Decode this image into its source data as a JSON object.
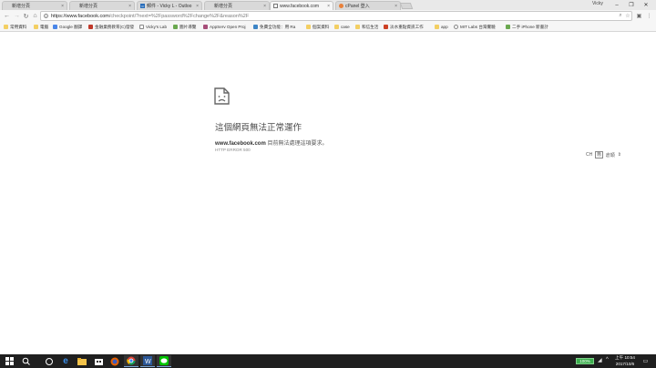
{
  "tabs": [
    {
      "title": "新增分頁",
      "favicon": "blank-page-icon",
      "active": false
    },
    {
      "title": "新增分頁",
      "favicon": "blank-page-icon",
      "active": false
    },
    {
      "title": "郵件 - Vicky L - Outloo",
      "favicon": "outlook-icon",
      "active": false
    },
    {
      "title": "新增分頁",
      "favicon": "blank-page-icon",
      "active": false
    },
    {
      "title": "www.facebook.com",
      "favicon": "facebook-icon",
      "active": true
    },
    {
      "title": "cPanel 登入",
      "favicon": "cpanel-icon",
      "active": false
    }
  ],
  "profile_name": "Vicky",
  "address": {
    "host": "https://www.facebook.com",
    "rest": "/checkpoint/?next=%2Fpassword%2Fchange%2F&reason%2F"
  },
  "bookmarks": [
    {
      "label": "常用資料",
      "icon": "folder-icon"
    },
    {
      "label": "電腦",
      "icon": "folder-icon"
    },
    {
      "label": "Google 翻譯",
      "icon": "google-translate-icon"
    },
    {
      "label": "金融業務教育(C)發發",
      "icon": "app-icon"
    },
    {
      "label": "Vicky's Lab",
      "icon": "page-icon"
    },
    {
      "label": "圖片導覽",
      "icon": "bookmark-icon"
    },
    {
      "label": "AppServ Open Proj",
      "icon": "appserv-icon"
    },
    {
      "label": "免費全功能：用 Ra",
      "icon": "bookmark-icon"
    },
    {
      "label": "個案資料",
      "icon": "folder-icon"
    },
    {
      "label": "case",
      "icon": "folder-icon"
    },
    {
      "label": "和信生活",
      "icon": "folder-icon"
    },
    {
      "label": "淡水重點資訊工作",
      "icon": "bookmark-icon"
    },
    {
      "label": "app",
      "icon": "folder-icon"
    },
    {
      "label": "MIT Labs 台灣實驗",
      "icon": "page-icon"
    },
    {
      "label": "二手 iPhone 新書計",
      "icon": "bookmark-icon"
    }
  ],
  "error": {
    "title": "這個網頁無法正常運作",
    "host": "www.facebook.com",
    "message": "目前無法處理這項要求。",
    "code": "HTTP ERROR 500"
  },
  "ime": {
    "lang": "CH",
    "mode": "簡",
    "label": "倉頡"
  },
  "taskbar": {
    "battery": "100%",
    "time": "上午 10:54",
    "date": "2017/10/6"
  },
  "colors": {
    "taskbar": "#1f1f1f",
    "battery": "#3cae4d",
    "facebook": "#3b5998"
  }
}
